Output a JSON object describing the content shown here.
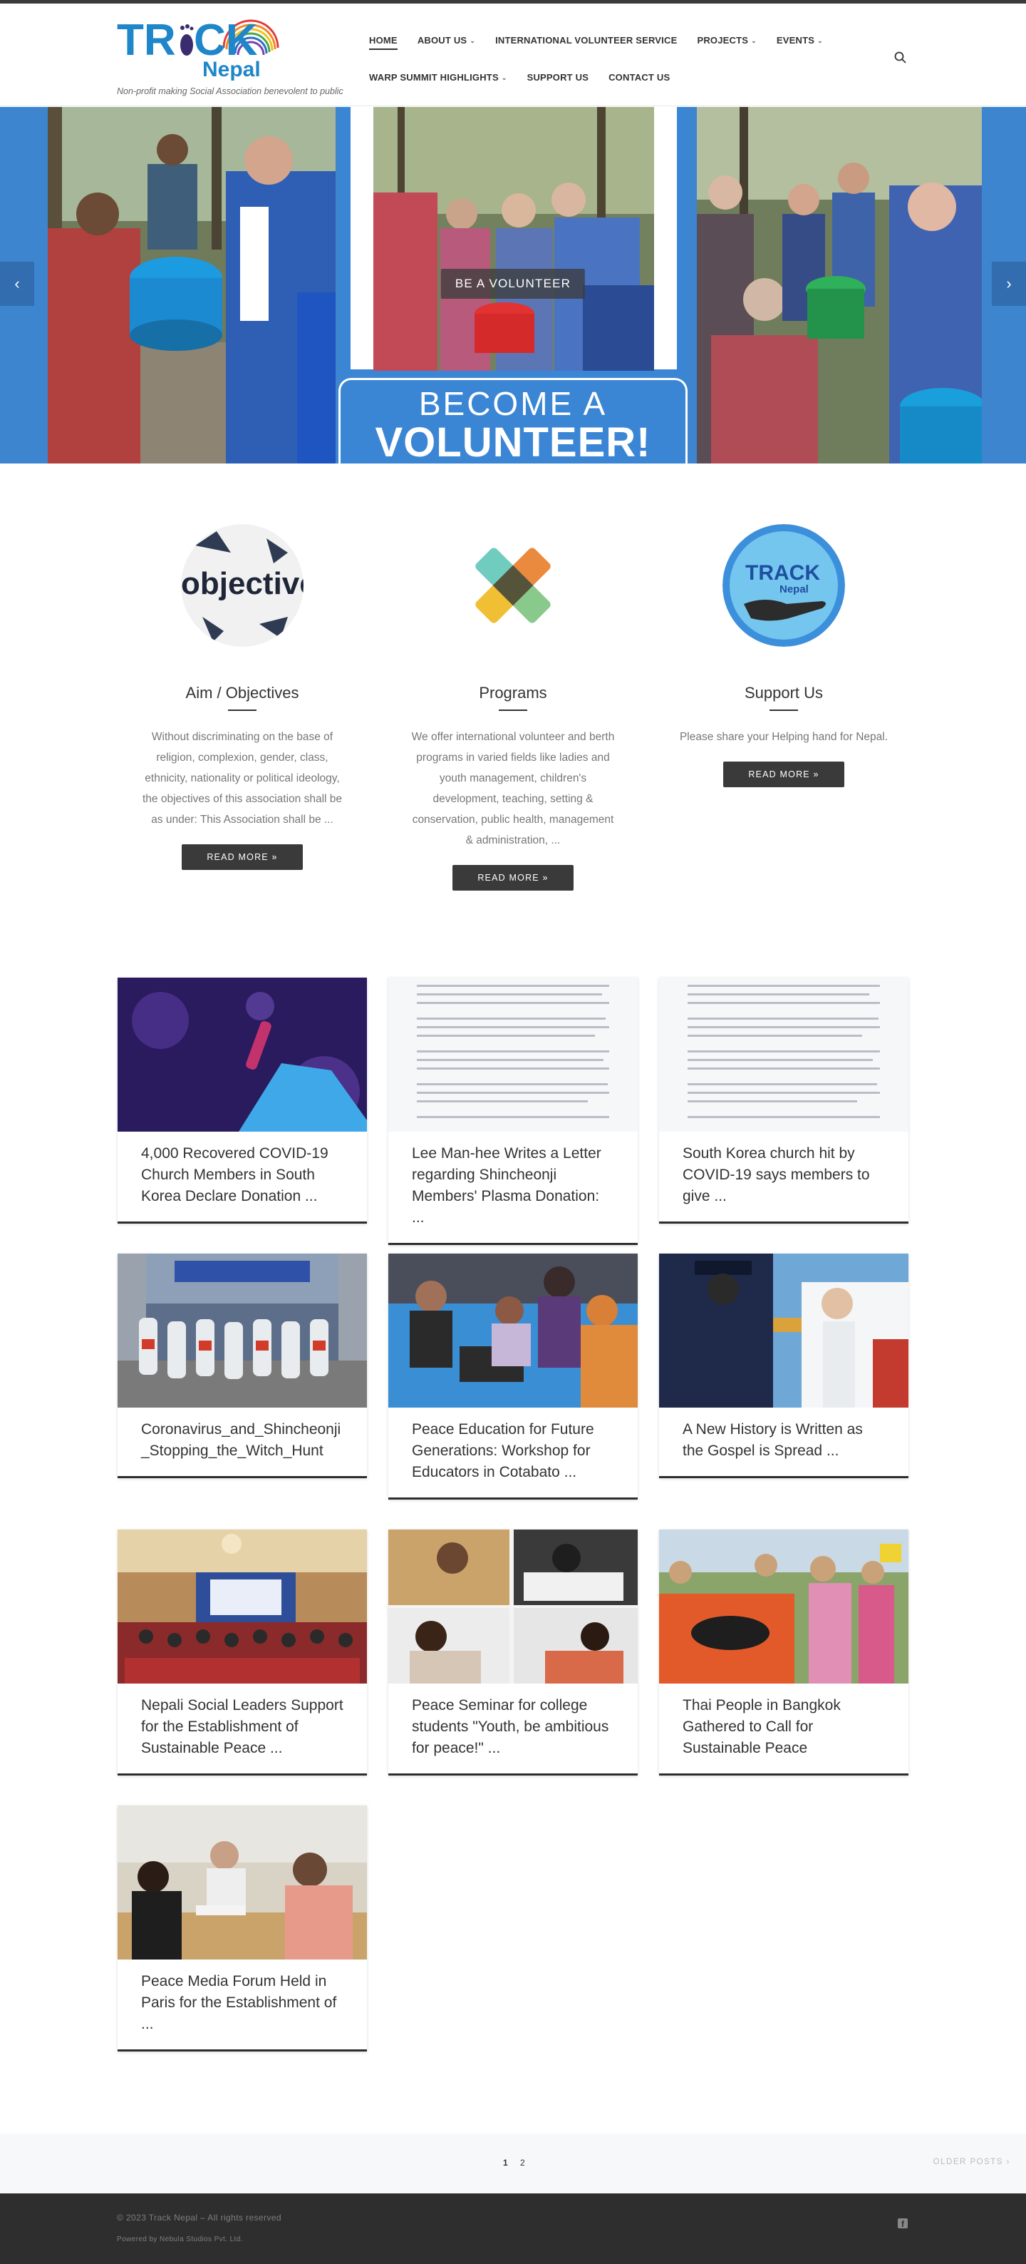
{
  "brand": {
    "logo_line1": "TRACK",
    "logo_line2": "Nepal",
    "tagline": "Non-profit making Social Association benevolent to public"
  },
  "nav": {
    "row1": [
      {
        "label": "HOME",
        "dropdown": false,
        "active": true
      },
      {
        "label": "ABOUT US",
        "dropdown": true
      },
      {
        "label": "INTERNATIONAL VOLUNTEER SERVICE",
        "dropdown": false
      },
      {
        "label": "PROJECTS",
        "dropdown": true
      },
      {
        "label": "EVENTS",
        "dropdown": true
      }
    ],
    "row2": [
      {
        "label": "WARP SUMMIT HIGHLIGHTS",
        "dropdown": true
      },
      {
        "label": "SUPPORT US",
        "dropdown": false
      },
      {
        "label": "CONTACT US",
        "dropdown": false
      }
    ],
    "search_icon": "search-icon"
  },
  "slider": {
    "button_label": "BE A VOLUNTEER",
    "banner_line1": "BECOME A",
    "banner_line2": "VOLUNTEER!",
    "prev_icon": "chevron-left-icon",
    "next_icon": "chevron-right-icon",
    "accent": "#3d85cf"
  },
  "features": [
    {
      "title": "Aim / Objectives",
      "icon_word": "objective",
      "text": "Without discriminating on the base of religion, complexion, gender, class, ethnicity, nationality or political ideology, the objectives of this association shall be as under: This Association shall be ...",
      "button": "READ MORE »"
    },
    {
      "title": "Programs",
      "text": "We offer international volunteer and berth programs in varied fields like ladies and youth management, children's development, teaching, setting & conservation, public health, management & administration, ...",
      "button": "READ MORE »"
    },
    {
      "title": "Support Us",
      "text": "Please share your Helping hand for Nepal.",
      "button": "READ MORE »"
    }
  ],
  "posts": [
    {
      "title": "4,000 Recovered COVID-19 Church Members in South Korea Declare Donation ..."
    },
    {
      "title": "Lee Man-hee Writes a Letter regarding Shincheonji Members' Plasma Donation: ..."
    },
    {
      "title": "South Korea church hit by COVID-19 says members to give ..."
    },
    {
      "title": "Coronavirus_and_Shincheonji _Stopping_the_Witch_Hunt"
    },
    {
      "title": "Peace Education for Future Generations: Workshop for Educators in Cotabato ..."
    },
    {
      "title": "A New History is Written as the Gospel is Spread ..."
    },
    {
      "title": "Nepali Social Leaders Support for the Establishment of Sustainable Peace ..."
    },
    {
      "title": "Peace Seminar for college students \"Youth, be ambitious for peace!\" ..."
    },
    {
      "title": "Thai People in Bangkok Gathered to Call for Sustainable Peace"
    },
    {
      "title": "Peace Media Forum Held in Paris for the Establishment of ..."
    }
  ],
  "pagination": {
    "pages": [
      "1",
      "2"
    ],
    "current": "1",
    "older": "OLDER POSTS ›"
  },
  "footer": {
    "copyright": "© 2023 Track Nepal – All rights reserved",
    "powered": "Powered by Nebula Studios Pvt. Ltd.",
    "social_icon": "facebook-icon"
  }
}
